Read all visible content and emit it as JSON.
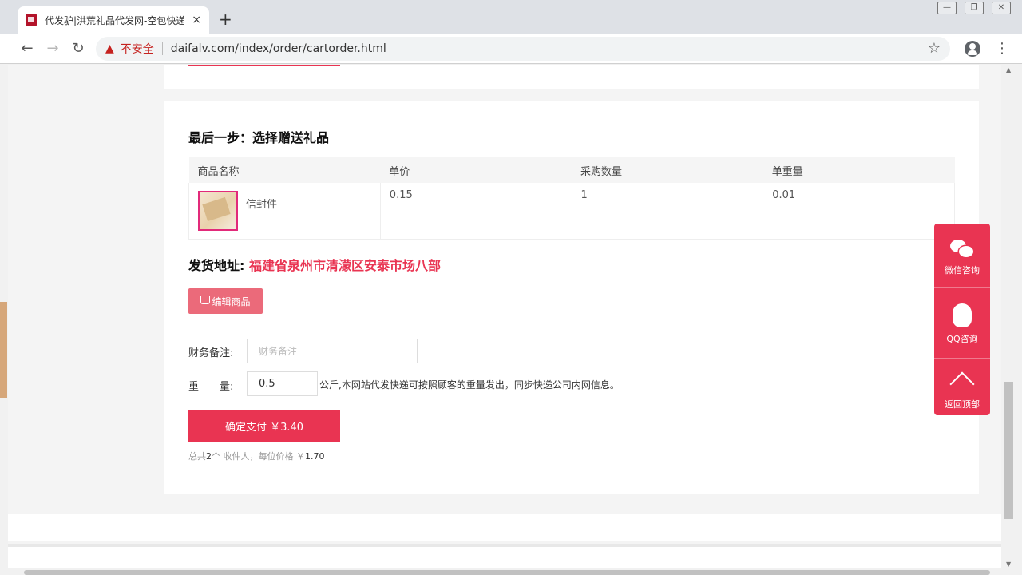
{
  "browser": {
    "tab_title": "代发驴|洪荒礼品代发网-空包快递",
    "tab_close": "×",
    "new_tab": "+",
    "insecure_label": "不安全",
    "url": "daifalv.com/index/order/cartorder.html"
  },
  "page": {
    "step_title": "最后一步：选择赠送礼品",
    "table": {
      "headers": [
        "商品名称",
        "单价",
        "采购数量",
        "单重量"
      ],
      "row": {
        "name": "信封件",
        "price": "0.15",
        "qty": "1",
        "weight": "0.01"
      }
    },
    "address_label": "发货地址:",
    "address_value": "福建省泉州市清濛区安泰市场八部",
    "edit_button": "编辑商品",
    "remark_label": "财务备注:",
    "remark_placeholder": "财务备注",
    "weight_label": "重　　量:",
    "weight_value": "0.5",
    "weight_note": "公斤,本网站代发快递可按照顾客的重量发出，同步快递公司内网信息。",
    "pay_button": "确定支付 ￥3.40",
    "summary": {
      "prefix": "总共",
      "count": "2",
      "middle": "个 收件人，每位价格 ￥",
      "price": "1.70"
    }
  },
  "float": {
    "wechat": "微信咨询",
    "qq": "QQ咨询",
    "top": "返回顶部"
  },
  "colors": {
    "accent": "#e93452",
    "edit_button": "#eb6a7a",
    "insecure": "#c5221f"
  }
}
